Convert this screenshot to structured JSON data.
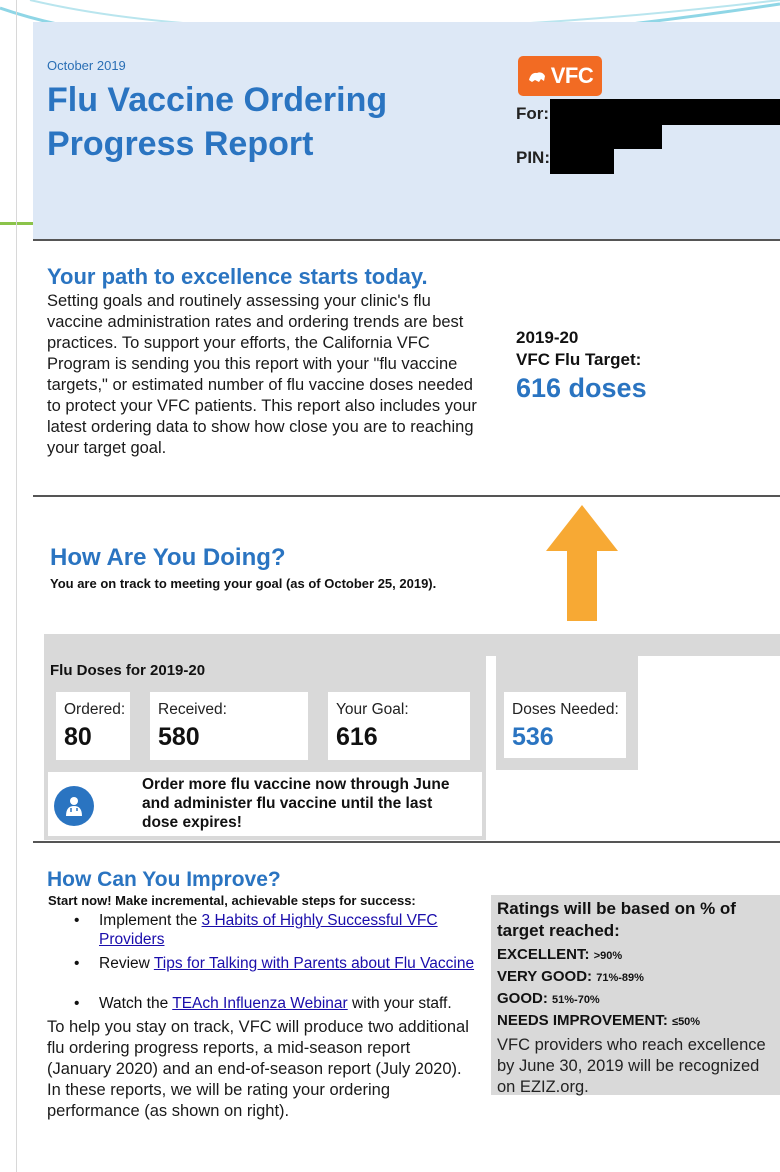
{
  "header": {
    "month": "October 2019",
    "title": "Flu Vaccine Ordering Progress Report",
    "logo_text": "VFC",
    "for_label": "For:",
    "pin_label": "PIN:"
  },
  "intro": {
    "heading": "Your path to excellence starts today.",
    "body": "Setting goals and routinely assessing your clinic's flu vaccine administration rates and ordering trends are best practices. To support your efforts, the California VFC Program is sending you this report with your \"flu vaccine targets,\" or estimated number of flu vaccine doses needed to protect your VFC patients. This report also includes your latest ordering data to show how close you are to reaching your target goal."
  },
  "target": {
    "year": "2019-20",
    "label": "VFC Flu Target:",
    "value": "616 doses"
  },
  "progress": {
    "heading": "How Are You Doing?",
    "status_text": "You are on track to meeting your goal (as of October 25, 2019).",
    "doses_title": "Flu Doses for 2019-20",
    "ordered_label": "Ordered:",
    "ordered_value": "80",
    "received_label": "Received:",
    "received_value": "580",
    "goal_label": "Your Goal:",
    "goal_value": "616",
    "needed_label": "Doses Needed:",
    "needed_value": "536",
    "order_message": "Order more flu vaccine now through June and administer flu vaccine until the last dose expires!"
  },
  "improve": {
    "heading": "How Can You Improve?",
    "intro": "Start now! Make incremental, achievable steps for success:",
    "step1_prefix": "Implement the ",
    "step1_link": "3 Habits of Highly Successful VFC Providers",
    "step2_prefix": "Review ",
    "step2_link": "Tips for Talking with Parents about Flu Vaccine",
    "step3_prefix": "Watch the ",
    "step3_link": "TEAch Influenza Webinar",
    "step3_suffix": " with your staff.",
    "footer": "To help you stay on track, VFC will produce two additional flu ordering progress reports, a mid-season report (January 2020) and an end-of-season report (July 2020). In these reports, we will be rating your ordering performance (as shown on right)."
  },
  "ratings": {
    "heading": "Ratings will be based on % of target reached:",
    "excellent_label": "EXCELLENT:",
    "excellent_value": ">90%",
    "very_good_label": "VERY GOOD:",
    "very_good_value": "71%-89%",
    "good_label": "GOOD:",
    "good_value": "51%-70%",
    "needs_label": "NEEDS IMPROVEMENT:",
    "needs_value": "≤50%",
    "note": "VFC providers who reach excellence by June 30, 2019 will be recognized on EZIZ.org."
  },
  "colors": {
    "accent_blue": "#2a74c1",
    "header_bg": "#dde8f6",
    "logo_orange": "#f26b23",
    "arrow_orange": "#f7a934",
    "panel_gray": "#d9d9d9"
  },
  "icons": {
    "logo": "bear-logo-icon",
    "arrow": "up-arrow-icon",
    "order": "doctor-icon"
  }
}
